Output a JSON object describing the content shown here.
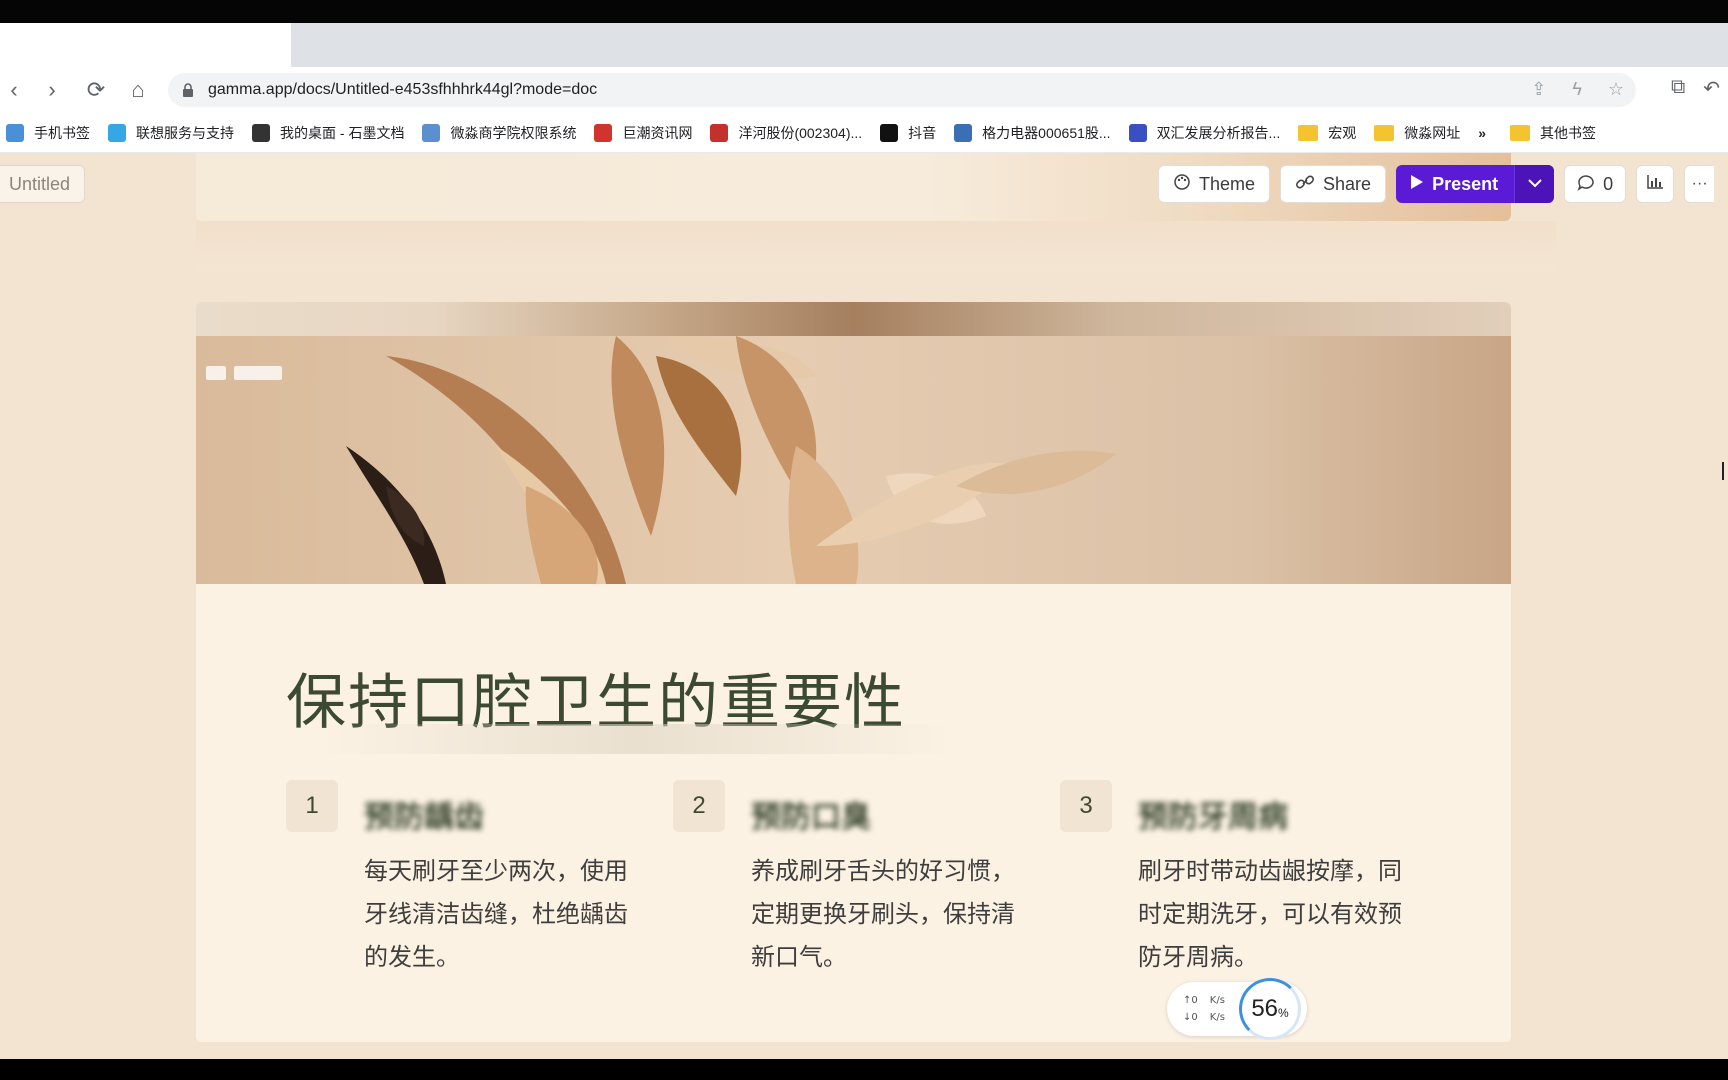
{
  "browser": {
    "url": "gamma.app/docs/Untitled-e453sfhhhrk44gl?mode=doc",
    "nav": {
      "back_icon": "‹",
      "forward_icon": "›",
      "reload_icon": "⟳",
      "home_icon": "⌂"
    },
    "bookmarks": [
      {
        "label": "手机书签",
        "color": "#4a90d9"
      },
      {
        "label": "联想服务与支持",
        "color": "#35a7e6"
      },
      {
        "label": "我的桌面 - 石墨文档",
        "color": "#333333"
      },
      {
        "label": "微淼商学院权限系统",
        "color": "#5b8fd0"
      },
      {
        "label": "巨潮资讯网",
        "color": "#d0342c"
      },
      {
        "label": "洋河股份(002304)...",
        "color": "#c4302b"
      },
      {
        "label": "抖音",
        "color": "#111111"
      },
      {
        "label": "格力电器000651股...",
        "color": "#3b6fb5"
      },
      {
        "label": "双汇发展分析报告...",
        "color": "#3a4fc4"
      },
      {
        "label": "宏观",
        "folder": true
      },
      {
        "label": "微淼网址",
        "folder": true
      }
    ],
    "more_bookmarks": "»",
    "other_bookmarks": "其他书签"
  },
  "app": {
    "doc_title": "Untitled",
    "toolbar": {
      "theme": "Theme",
      "share": "Share",
      "present": "Present",
      "comments_count": "0",
      "more": "···"
    }
  },
  "card": {
    "heading": "保持口腔卫生的重要性",
    "columns": [
      {
        "num": "1",
        "title": "预防龋齿",
        "text": "每天刷牙至少两次，使用牙线清洁齿缝，杜绝龋齿的发生。"
      },
      {
        "num": "2",
        "title": "预防口臭",
        "text": "养成刷牙舌头的好习惯，定期更换牙刷头，保持清新口气。"
      },
      {
        "num": "3",
        "title": "预防牙周病",
        "text": "刷牙时带动齿龈按摩，同时定期洗牙，可以有效预防牙周病。"
      }
    ]
  },
  "net_widget": {
    "up": "0",
    "down": "0",
    "unit": "K/s",
    "percent": "56",
    "percent_sign": "%"
  }
}
